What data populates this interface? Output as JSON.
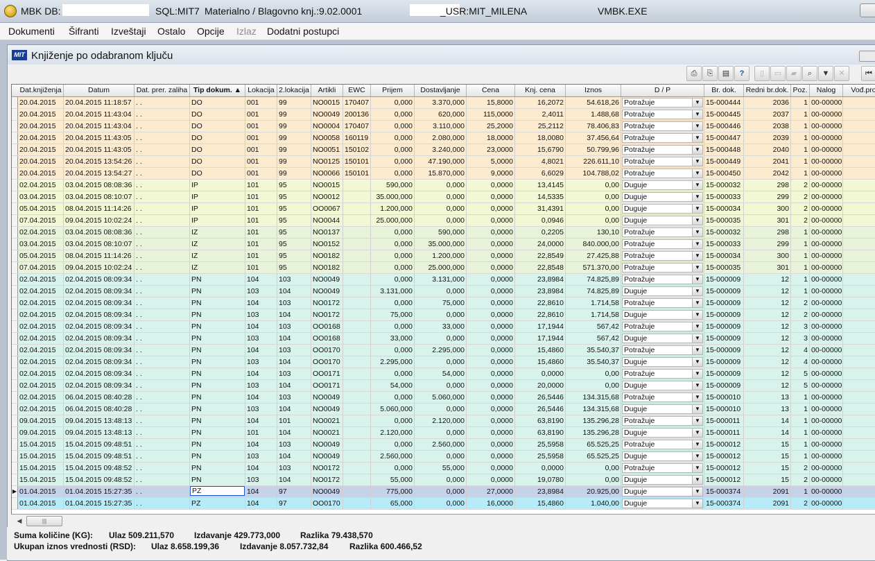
{
  "window": {
    "title_prefix": "MBK  DB:",
    "sql": "SQL:MIT7",
    "module": "Materialno / Blagovno knj.:9.02.0001",
    "usr": "_USR:MIT_MILENA",
    "exe": "VMBK.EXE"
  },
  "menu": [
    {
      "label": "Dokumenti",
      "disabled": false
    },
    {
      "label": "Šifranti",
      "disabled": false
    },
    {
      "label": "Izveštaji",
      "disabled": false
    },
    {
      "label": "Ostalo",
      "disabled": false
    },
    {
      "label": "Opcije",
      "disabled": false
    },
    {
      "label": "Izlaz",
      "disabled": true
    },
    {
      "label": "Dodatni postupci",
      "disabled": false
    }
  ],
  "child": {
    "logo": "MIT",
    "title": "Knjiženje po odabranom ključu"
  },
  "toolbar": {
    "icons": [
      "print-icon",
      "print-setup-icon",
      "preview-icon",
      "help-icon",
      "new-icon",
      "open-icon",
      "save-icon",
      "find-icon",
      "filter-icon",
      "clear-filter-icon",
      "first-record-icon",
      "prev-record-icon"
    ]
  },
  "grid": {
    "columns": [
      "Dat.knjiženja",
      "Datum",
      "Dat. prer. zaliha",
      "Tip dokum.",
      "Lokacija",
      "2.lokacija",
      "Artikli",
      "EWC",
      "Prijem",
      "Dostavljanje",
      "Cena",
      "Knj. cena",
      "Iznos",
      "D / P",
      "Br. dok.",
      "Redni br.dok.",
      "Poz.",
      "Nalog",
      "Vođ.pro"
    ],
    "rows": [
      [
        "20.04.2015",
        "20.04.2015 11:18:57",
        ". .",
        "DO",
        "001",
        "99",
        "NO0015",
        "170407",
        "0,000",
        "3.370,000",
        "15,8000",
        "16,2072",
        "54.618,26",
        "Potražuje",
        "15-000444",
        "2036",
        "1",
        "00-00000",
        ""
      ],
      [
        "20.04.2015",
        "20.04.2015 11:43:04",
        ". .",
        "DO",
        "001",
        "99",
        "NO0049",
        "200136",
        "0,000",
        "620,000",
        "115,0000",
        "2,4011",
        "1.488,68",
        "Potražuje",
        "15-000445",
        "2037",
        "1",
        "00-00000",
        ""
      ],
      [
        "20.04.2015",
        "20.04.2015 11:43:04",
        ". .",
        "DO",
        "001",
        "99",
        "NO0004",
        "170407",
        "0,000",
        "3.110,000",
        "25,2000",
        "25,2112",
        "78.406,83",
        "Potražuje",
        "15-000446",
        "2038",
        "1",
        "00-00000",
        ""
      ],
      [
        "20.04.2015",
        "20.04.2015 11:43:05",
        ". .",
        "DO",
        "001",
        "99",
        "NO0058",
        "160119",
        "0,000",
        "2.080,000",
        "18,0000",
        "18,0080",
        "37.456,64",
        "Potražuje",
        "15-000447",
        "2039",
        "1",
        "00-00000",
        ""
      ],
      [
        "20.04.2015",
        "20.04.2015 11:43:05",
        ". .",
        "DO",
        "001",
        "99",
        "NO0051",
        "150102",
        "0,000",
        "3.240,000",
        "23,0000",
        "15,6790",
        "50.799,96",
        "Potražuje",
        "15-000448",
        "2040",
        "1",
        "00-00000",
        ""
      ],
      [
        "20.04.2015",
        "20.04.2015 13:54:26",
        ". .",
        "DO",
        "001",
        "99",
        "NO0125",
        "150101",
        "0,000",
        "47.190,000",
        "5,0000",
        "4,8021",
        "226.611,10",
        "Potražuje",
        "15-000449",
        "2041",
        "1",
        "00-00000",
        ""
      ],
      [
        "20.04.2015",
        "20.04.2015 13:54:27",
        ". .",
        "DO",
        "001",
        "99",
        "NO0066",
        "150101",
        "0,000",
        "15.870,000",
        "9,0000",
        "6,6029",
        "104.788,02",
        "Potražuje",
        "15-000450",
        "2042",
        "1",
        "00-00000",
        ""
      ],
      [
        "02.04.2015",
        "03.04.2015 08:08:36",
        ". .",
        "IP",
        "101",
        "95",
        "NO0015",
        "",
        "590,000",
        "0,000",
        "0,0000",
        "13,4145",
        "0,00",
        "Duguje",
        "15-000032",
        "298",
        "2",
        "00-00000",
        ""
      ],
      [
        "03.04.2015",
        "03.04.2015 08:10:07",
        ". .",
        "IP",
        "101",
        "95",
        "NO0012",
        "",
        "35.000,000",
        "0,000",
        "0,0000",
        "14,5335",
        "0,00",
        "Duguje",
        "15-000033",
        "299",
        "2",
        "00-00000",
        ""
      ],
      [
        "05.04.2015",
        "08.04.2015 11:14:26",
        ". .",
        "IP",
        "101",
        "95",
        "OO0067",
        "",
        "1.200,000",
        "0,000",
        "0,0000",
        "31,4391",
        "0,00",
        "Duguje",
        "15-000034",
        "300",
        "2",
        "00-00000",
        ""
      ],
      [
        "07.04.2015",
        "09.04.2015 10:02:24",
        ". .",
        "IP",
        "101",
        "95",
        "NO0044",
        "",
        "25.000,000",
        "0,000",
        "0,0000",
        "0,0946",
        "0,00",
        "Duguje",
        "15-000035",
        "301",
        "2",
        "00-00000",
        ""
      ],
      [
        "02.04.2015",
        "03.04.2015 08:08:36",
        ". .",
        "IZ",
        "101",
        "95",
        "NO0137",
        "",
        "0,000",
        "590,000",
        "0,0000",
        "0,2205",
        "130,10",
        "Potražuje",
        "15-000032",
        "298",
        "1",
        "00-00000",
        ""
      ],
      [
        "03.04.2015",
        "03.04.2015 08:10:07",
        ". .",
        "IZ",
        "101",
        "95",
        "NO0152",
        "",
        "0,000",
        "35.000,000",
        "0,0000",
        "24,0000",
        "840.000,00",
        "Potražuje",
        "15-000033",
        "299",
        "1",
        "00-00000",
        ""
      ],
      [
        "05.04.2015",
        "08.04.2015 11:14:26",
        ". .",
        "IZ",
        "101",
        "95",
        "NO0182",
        "",
        "0,000",
        "1.200,000",
        "0,0000",
        "22,8549",
        "27.425,88",
        "Potražuje",
        "15-000034",
        "300",
        "1",
        "00-00000",
        ""
      ],
      [
        "07.04.2015",
        "09.04.2015 10:02:24",
        ". .",
        "IZ",
        "101",
        "95",
        "NO0182",
        "",
        "0,000",
        "25.000,000",
        "0,0000",
        "22,8548",
        "571.370,00",
        "Potražuje",
        "15-000035",
        "301",
        "1",
        "00-00000",
        ""
      ],
      [
        "02.04.2015",
        "02.04.2015 08:09:34",
        ". .",
        "PN",
        "104",
        "103",
        "NO0049",
        "",
        "0,000",
        "3.131,000",
        "0,0000",
        "23,8984",
        "74.825,89",
        "Potražuje",
        "15-000009",
        "12",
        "1",
        "00-00000",
        ""
      ],
      [
        "02.04.2015",
        "02.04.2015 08:09:34",
        ". .",
        "PN",
        "103",
        "104",
        "NO0049",
        "",
        "3.131,000",
        "0,000",
        "0,0000",
        "23,8984",
        "74.825,89",
        "Duguje",
        "15-000009",
        "12",
        "1",
        "00-00000",
        ""
      ],
      [
        "02.04.2015",
        "02.04.2015 08:09:34",
        ". .",
        "PN",
        "104",
        "103",
        "NO0172",
        "",
        "0,000",
        "75,000",
        "0,0000",
        "22,8610",
        "1.714,58",
        "Potražuje",
        "15-000009",
        "12",
        "2",
        "00-00000",
        ""
      ],
      [
        "02.04.2015",
        "02.04.2015 08:09:34",
        ". .",
        "PN",
        "103",
        "104",
        "NO0172",
        "",
        "75,000",
        "0,000",
        "0,0000",
        "22,8610",
        "1.714,58",
        "Duguje",
        "15-000009",
        "12",
        "2",
        "00-00000",
        ""
      ],
      [
        "02.04.2015",
        "02.04.2015 08:09:34",
        ". .",
        "PN",
        "104",
        "103",
        "OO0168",
        "",
        "0,000",
        "33,000",
        "0,0000",
        "17,1944",
        "567,42",
        "Potražuje",
        "15-000009",
        "12",
        "3",
        "00-00000",
        ""
      ],
      [
        "02.04.2015",
        "02.04.2015 08:09:34",
        ". .",
        "PN",
        "103",
        "104",
        "OO0168",
        "",
        "33,000",
        "0,000",
        "0,0000",
        "17,1944",
        "567,42",
        "Duguje",
        "15-000009",
        "12",
        "3",
        "00-00000",
        ""
      ],
      [
        "02.04.2015",
        "02.04.2015 08:09:34",
        ". .",
        "PN",
        "104",
        "103",
        "OO0170",
        "",
        "0,000",
        "2.295,000",
        "0,0000",
        "15,4860",
        "35.540,37",
        "Potražuje",
        "15-000009",
        "12",
        "4",
        "00-00000",
        ""
      ],
      [
        "02.04.2015",
        "02.04.2015 08:09:34",
        ". .",
        "PN",
        "103",
        "104",
        "OO0170",
        "",
        "2.295,000",
        "0,000",
        "0,0000",
        "15,4860",
        "35.540,37",
        "Duguje",
        "15-000009",
        "12",
        "4",
        "00-00000",
        ""
      ],
      [
        "02.04.2015",
        "02.04.2015 08:09:34",
        ". .",
        "PN",
        "104",
        "103",
        "OO0171",
        "",
        "0,000",
        "54,000",
        "0,0000",
        "0,0000",
        "0,00",
        "Potražuje",
        "15-000009",
        "12",
        "5",
        "00-00000",
        ""
      ],
      [
        "02.04.2015",
        "02.04.2015 08:09:34",
        ". .",
        "PN",
        "103",
        "104",
        "OO0171",
        "",
        "54,000",
        "0,000",
        "0,0000",
        "20,0000",
        "0,00",
        "Duguje",
        "15-000009",
        "12",
        "5",
        "00-00000",
        ""
      ],
      [
        "02.04.2015",
        "06.04.2015 08:40:28",
        ". .",
        "PN",
        "104",
        "103",
        "NO0049",
        "",
        "0,000",
        "5.060,000",
        "0,0000",
        "26,5446",
        "134.315,68",
        "Potražuje",
        "15-000010",
        "13",
        "1",
        "00-00000",
        ""
      ],
      [
        "02.04.2015",
        "06.04.2015 08:40:28",
        ". .",
        "PN",
        "103",
        "104",
        "NO0049",
        "",
        "5.060,000",
        "0,000",
        "0,0000",
        "26,5446",
        "134.315,68",
        "Duguje",
        "15-000010",
        "13",
        "1",
        "00-00000",
        ""
      ],
      [
        "09.04.2015",
        "09.04.2015 13:48:13",
        ". .",
        "PN",
        "104",
        "101",
        "NO0021",
        "",
        "0,000",
        "2.120,000",
        "0,0000",
        "63,8190",
        "135.296,28",
        "Potražuje",
        "15-000011",
        "14",
        "1",
        "00-00000",
        ""
      ],
      [
        "09.04.2015",
        "09.04.2015 13:48:13",
        ". .",
        "PN",
        "101",
        "104",
        "NO0021",
        "",
        "2.120,000",
        "0,000",
        "0,0000",
        "63,8190",
        "135.296,28",
        "Duguje",
        "15-000011",
        "14",
        "1",
        "00-00000",
        ""
      ],
      [
        "15.04.2015",
        "15.04.2015 09:48:51",
        ". .",
        "PN",
        "104",
        "103",
        "NO0049",
        "",
        "0,000",
        "2.560,000",
        "0,0000",
        "25,5958",
        "65.525,25",
        "Potražuje",
        "15-000012",
        "15",
        "1",
        "00-00000",
        ""
      ],
      [
        "15.04.2015",
        "15.04.2015 09:48:51",
        ". .",
        "PN",
        "103",
        "104",
        "NO0049",
        "",
        "2.560,000",
        "0,000",
        "0,0000",
        "25,5958",
        "65.525,25",
        "Duguje",
        "15-000012",
        "15",
        "1",
        "00-00000",
        ""
      ],
      [
        "15.04.2015",
        "15.04.2015 09:48:52",
        ". .",
        "PN",
        "104",
        "103",
        "NO0172",
        "",
        "0,000",
        "55,000",
        "0,0000",
        "0,0000",
        "0,00",
        "Potražuje",
        "15-000012",
        "15",
        "2",
        "00-00000",
        ""
      ],
      [
        "15.04.2015",
        "15.04.2015 09:48:52",
        ". .",
        "PN",
        "103",
        "104",
        "NO0172",
        "",
        "55,000",
        "0,000",
        "0,0000",
        "19,0780",
        "0,00",
        "Duguje",
        "15-000012",
        "15",
        "2",
        "00-00000",
        ""
      ],
      [
        "01.04.2015",
        "01.04.2015 15:27:35",
        ". .",
        "PZ",
        "104",
        "97",
        "NO0049",
        "",
        "775,000",
        "0,000",
        "27,0000",
        "23,8984",
        "20.925,00",
        "Duguje",
        "15-000374",
        "2091",
        "1",
        "00-00000",
        ""
      ],
      [
        "01.04.2015",
        "01.04.2015 15:27:35",
        ". .",
        "PZ",
        "104",
        "97",
        "OO0170",
        "",
        "65,000",
        "0,000",
        "16,0000",
        "15,4860",
        "1.040,00",
        "Duguje",
        "15-000374",
        "2091",
        "2",
        "00-00000",
        ""
      ]
    ]
  },
  "summary": {
    "line1_label": "Suma količine (KG):",
    "ulaz1": "Ulaz 509.211,570",
    "izdavanje1": "Izdavanje 429.773,000",
    "razlika1": "Razlika 79.438,570",
    "line2_label": "Ukupan iznos vrednosti (RSD):",
    "ulaz2": "Ulaz 8.658.199,36",
    "izdavanje2": "Izdavanje 8.057.732,84",
    "razlika2": "Razlika 600.466,52"
  },
  "colors": {
    "do": "#fdebd0",
    "ip": "#f2f8d4",
    "iz": "#e8f3d9",
    "pn": "#d8f2ec",
    "pz": "#d9f4fb",
    "selected": "#c5d2e7",
    "pz2": "#b6ecfa"
  }
}
